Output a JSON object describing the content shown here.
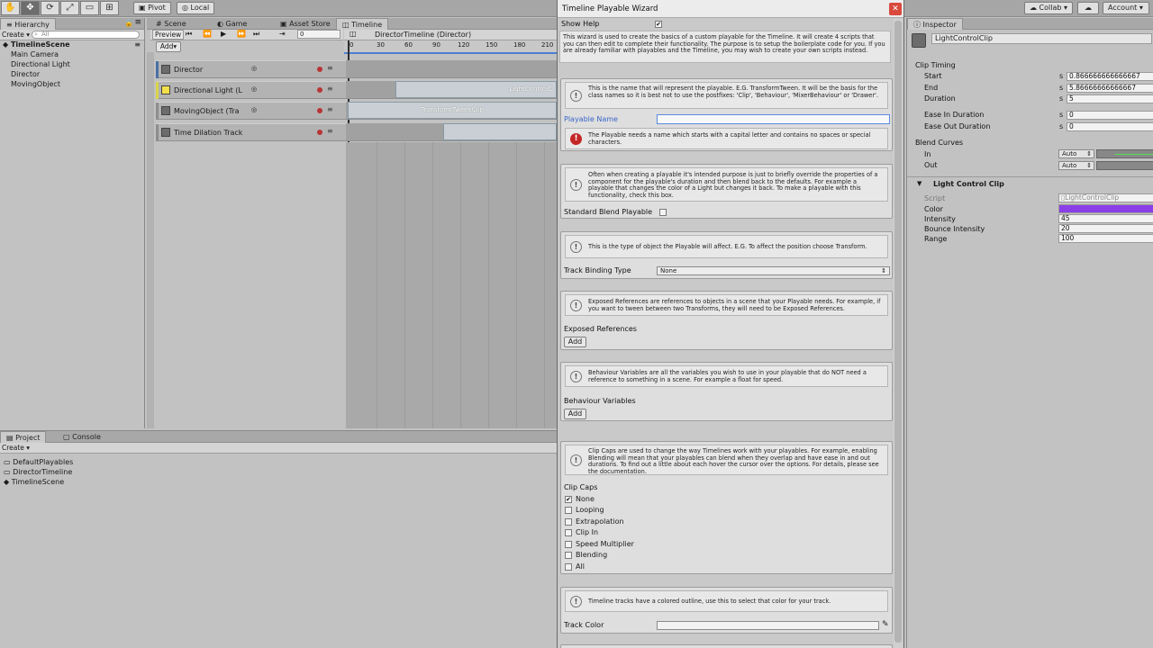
{
  "toolbar": {
    "pivot_label": "Pivot",
    "local_label": "Local",
    "collab_label": "Collab ▾",
    "account_label": "Account"
  },
  "hierarchy": {
    "tab_label": "Hierarchy",
    "create_label": "Create ▾",
    "search_placeholder": "All",
    "scene_name": "TimelineScene",
    "items": [
      {
        "label": "Main Camera"
      },
      {
        "label": "Directional Light"
      },
      {
        "label": "Director"
      },
      {
        "label": "MovingObject"
      }
    ]
  },
  "timeline": {
    "tabs": [
      {
        "label": "Scene"
      },
      {
        "label": "Game"
      },
      {
        "label": "Asset Store"
      },
      {
        "label": "Timeline"
      }
    ],
    "preview_label": "Preview",
    "frame_value": "0",
    "add_label": "Add▾",
    "asset_title": "DirectorTimeline (Director)",
    "ruler": [
      "0",
      "30",
      "60",
      "90",
      "120",
      "150",
      "180",
      "210"
    ],
    "tracks": [
      {
        "label": "Director",
        "accent": "#4a6fa5"
      },
      {
        "label": "Directional Light (L",
        "accent": "#d8d44a"
      },
      {
        "label": "MovingObject (Tra",
        "accent": "#8d8d8d"
      },
      {
        "label": "Time Dilation Track",
        "accent": "#8d8d8d"
      }
    ],
    "clips": [
      {
        "label": "LightControlC"
      },
      {
        "label": "TransformTweenClip"
      },
      {
        "label": ""
      }
    ]
  },
  "project": {
    "tabs": [
      {
        "label": "Project"
      },
      {
        "label": "Console"
      }
    ],
    "create_label": "Create ▾",
    "items": [
      {
        "label": "DefaultPlayables"
      },
      {
        "label": "DirectorTimeline"
      },
      {
        "label": "TimelineScene"
      }
    ]
  },
  "wizard": {
    "title": "Timeline Playable Wizard",
    "show_help_label": "Show Help",
    "show_help_checked": "✔",
    "intro_text": "This wizard is used to create the basics of a custom playable for the Timeline. It will create 4 scripts that you can then edit to complete their functionality. The purpose is to setup the boilerplate code for you.  If you are already familiar with playables and the Timeline, you may wish to create your own scripts instead.",
    "name_help": "This is the name that will represent the playable.  E.G. TransformTween.  It will be the basis for the class names so it is best not to use the postfixes: 'Clip', 'Behaviour', 'MixerBehaviour' or 'Drawer'.",
    "playable_name_label": "Playable Name",
    "playable_name_value": "",
    "name_error": "The Playable needs a name which starts with a capital letter and contains no spaces or special characters.",
    "blend_help": "Often when creating a playable it's intended purpose is just to briefly override the properties of a component for the playable's duration and then blend back to the defaults.  For example a playable that changes the color of a Light but changes it back.  To make a playable with this functionality, check this box.",
    "standard_blend_label": "Standard Blend Playable",
    "binding_help": "This is the type of object the Playable will affect.  E.G. To affect the position choose Transform.",
    "track_binding_label": "Track Binding Type",
    "track_binding_value": "None",
    "exposed_help": "Exposed References are references to objects in a scene that your Playable needs. For example, if you want to tween between two Transforms, they will need to be Exposed References.",
    "exposed_label": "Exposed References",
    "add_label": "Add",
    "behaviour_help": "Behaviour Variables are all the variables you wish to use in your playable that do NOT need a reference to something in a scene.  For example a float for speed.",
    "behaviour_label": "Behaviour Variables",
    "caps_help": "Clip Caps are used to change the way Timelines work with your playables.  For example, enabling Blending will mean that your playables can blend when they overlap and have ease in and out durations.  To find out a little about each hover the cursor over the options.  For details, please see the documentation.",
    "clip_caps_label": "Clip Caps",
    "clip_caps": [
      {
        "label": "None",
        "mark": "✔"
      },
      {
        "label": "Looping",
        "mark": ""
      },
      {
        "label": "Extrapolation",
        "mark": ""
      },
      {
        "label": "Clip In",
        "mark": ""
      },
      {
        "label": "Speed Multiplier",
        "mark": ""
      },
      {
        "label": "Blending",
        "mark": ""
      },
      {
        "label": "All",
        "mark": ""
      }
    ],
    "color_help": "Timeline tracks have a colored outline, use this to select that color for your track.",
    "track_color_label": "Track Color",
    "track_color_value": "#f2f2f2"
  },
  "inspector": {
    "tab_label": "Inspector",
    "object_name": "LightControlClip",
    "clip_timing_label": "Clip Timing",
    "fields": [
      {
        "label": "Start",
        "unit": "s",
        "value": "0.866666666666667"
      },
      {
        "label": "End",
        "unit": "s",
        "value": "5.86666666666667"
      },
      {
        "label": "Duration",
        "unit": "s",
        "value": "5"
      }
    ],
    "ease_fields": [
      {
        "label": "Ease In Duration",
        "unit": "s",
        "value": "0"
      },
      {
        "label": "Ease Out Duration",
        "unit": "s",
        "value": "0"
      }
    ],
    "blend_curves_label": "Blend Curves",
    "blend_in_label": "In",
    "blend_out_label": "Out",
    "blend_in_mode": "Auto",
    "blend_out_mode": "Auto",
    "component_title": "Light Control Clip",
    "script_label": "Script",
    "script_value": "LightControlClip",
    "color_label": "Color",
    "color_value": "#8a3fe8",
    "intensity_label": "Intensity",
    "intensity_value": "45",
    "bounce_label": "Bounce Intensity",
    "bounce_value": "20",
    "range_label": "Range",
    "range_value": "100"
  }
}
